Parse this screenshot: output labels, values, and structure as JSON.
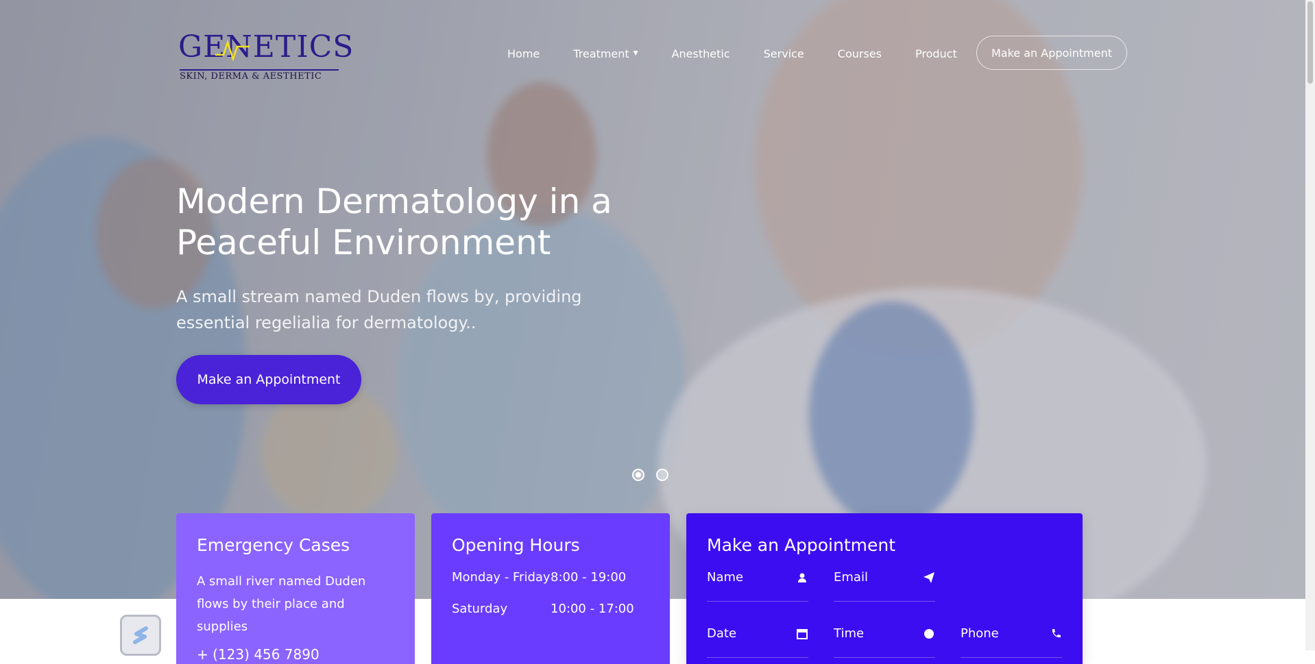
{
  "brand": {
    "logo_word": "GENETICS",
    "logo_sub": "SKIN, DERMA & AESTHETIC",
    "colors": {
      "primary": "#4a22d8",
      "card1": "#8b63ff",
      "card2": "#6a3cff",
      "card3": "#3c0df0",
      "logo": "#2a1c8a",
      "logo_accent": "#f2e21c"
    }
  },
  "nav": {
    "items": [
      {
        "label": "Home"
      },
      {
        "label": "Treatment",
        "icon": "caret-down-icon"
      },
      {
        "label": "Anesthetic"
      },
      {
        "label": "Service"
      },
      {
        "label": "Courses"
      },
      {
        "label": "Product"
      }
    ],
    "cta_label": "Make an Appointment"
  },
  "hero": {
    "title": "Modern Dermatology in a Peaceful Environment",
    "subtitle": "A small stream named Duden flows by, providing essential regelialia for dermatology..",
    "button_label": "Make an Appointment",
    "slides": 2,
    "active_slide": 1
  },
  "cards": {
    "emergency": {
      "title": "Emergency Cases",
      "text": "A small river named Duden flows by their place and supplies",
      "phone": "+ (123) 456 7890"
    },
    "hours": {
      "title": "Opening Hours",
      "rows": [
        {
          "day": "Monday - Friday",
          "time": "8:00 - 19:00"
        },
        {
          "day": "Saturday",
          "time": "10:00 - 17:00"
        }
      ]
    },
    "appointment": {
      "title": "Make an Appointment",
      "fields": [
        {
          "label": "Name",
          "icon": "user-icon"
        },
        {
          "label": "Email",
          "icon": "paper-plane-icon"
        },
        {
          "label": "Date",
          "icon": "calendar-icon"
        },
        {
          "label": "Time",
          "icon": "clock-icon"
        },
        {
          "label": "Phone",
          "icon": "phone-icon"
        }
      ]
    }
  }
}
